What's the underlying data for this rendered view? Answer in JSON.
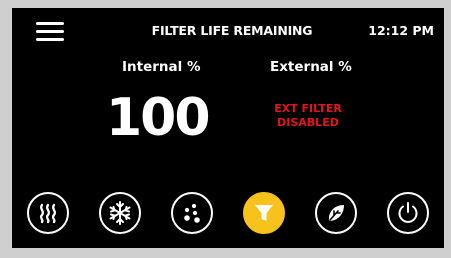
{
  "header": {
    "menu_icon": "hamburger-menu-icon",
    "title": "FILTER LIFE REMAINING",
    "time": "12:12 PM"
  },
  "filters": {
    "internal_label": "Internal %",
    "external_label": "External %",
    "internal_value": "100",
    "external_status_line1": "EXT FILTER",
    "external_status_line2": "DISABLED"
  },
  "bottom_bar": {
    "buttons": [
      {
        "icon": "heat-icon",
        "active": false
      },
      {
        "icon": "snowflake-icon",
        "active": false
      },
      {
        "icon": "dots-icon",
        "active": false
      },
      {
        "icon": "filter-funnel-icon",
        "active": true
      },
      {
        "icon": "leaf-icon",
        "active": false
      },
      {
        "icon": "power-icon",
        "active": false
      }
    ]
  },
  "colors": {
    "background": "#000000",
    "text": "#ffffff",
    "warning": "#e4141b",
    "accent": "#f7c21b"
  }
}
